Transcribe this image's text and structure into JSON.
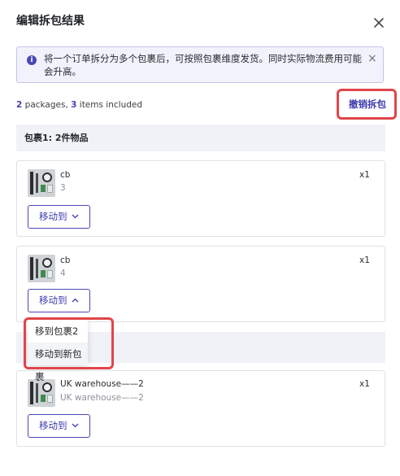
{
  "dialog": {
    "title": "编辑拆包结果"
  },
  "banner": {
    "message": "将一个订单拆分为多个包裹后，可按照包裹维度发货。同时实际物流费用可能会升高。",
    "info_icon": "i",
    "close": "×",
    "accent_color": "#4b48b5"
  },
  "summary": {
    "package_count": "2",
    "packages_text": " packages, ",
    "item_count": "3",
    "items_text": " items included"
  },
  "actions": {
    "undo_split": "撤销拆包"
  },
  "packages": [
    {
      "header": "包裹1: 2件物品",
      "items": [
        {
          "name": "cb",
          "qty": "3",
          "count": "x1",
          "move_label": "移动到"
        },
        {
          "name": "cb",
          "qty": "4",
          "count": "x1",
          "move_label": "移动到"
        }
      ]
    },
    {
      "items": [
        {
          "name": "UK warehouse——2",
          "qty": "UK warehouse——2",
          "count": "x1",
          "move_label": "移动到"
        }
      ]
    }
  ],
  "move_menu": {
    "options": [
      "移到包裹2",
      "移动到新包裹"
    ]
  },
  "highlight_color": "#e0454a"
}
